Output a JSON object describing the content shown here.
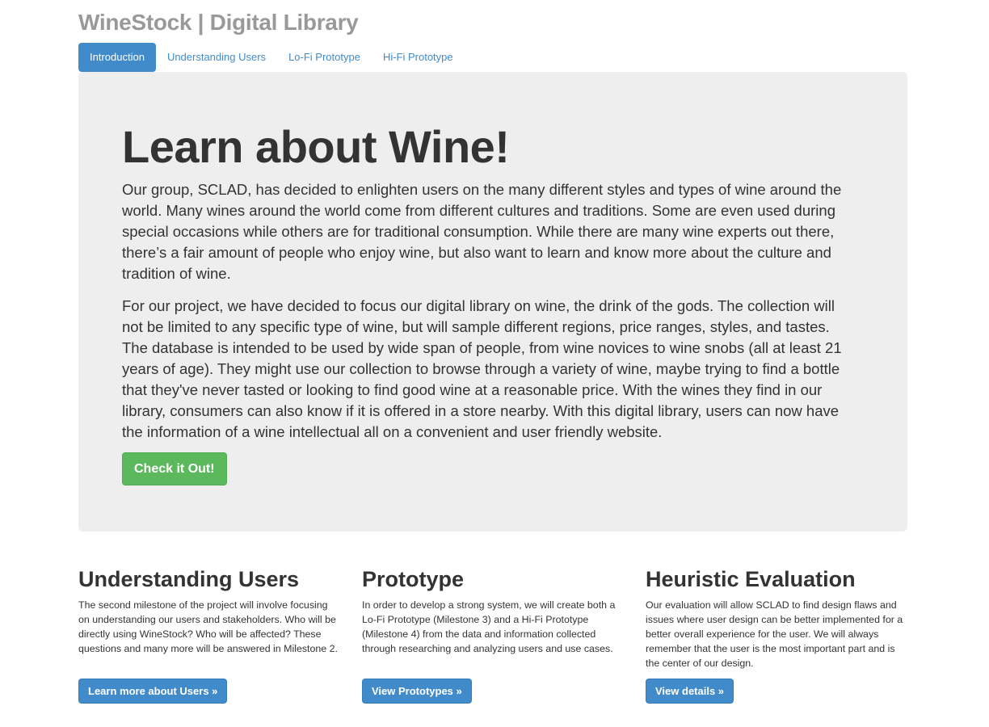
{
  "site": {
    "title": "WineStock | Digital Library"
  },
  "nav": {
    "tabs": [
      {
        "label": "Introduction",
        "active": true
      },
      {
        "label": "Understanding Users",
        "active": false
      },
      {
        "label": "Lo-Fi Prototype",
        "active": false
      },
      {
        "label": "Hi-Fi Prototype",
        "active": false
      }
    ]
  },
  "hero": {
    "heading": "Learn about Wine!",
    "paragraph_1": "Our group, SCLAD, has decided to enlighten users on the many different styles and types of wine around the world. Many wines around the world come from different cultures and traditions. Some are even used during special occasions while others are for traditional consumption. While there are many wine experts out there, there’s a fair amount of people who enjoy wine, but also want to learn and know more about the culture and tradition of wine.",
    "paragraph_2": "For our project, we have decided to focus our digital library on wine, the drink of the gods. The collection will not be limited to any specific type of wine, but will sample different regions, price ranges, styles, and tastes. The database is intended to be used by wide span of people, from wine novices to wine snobs (all at least 21 years of age). They might use our collection to browse through a variety of wine, maybe trying to find a bottle that they've never tasted or looking to find good wine at a reasonable price. With the wines they find in our library, consumers can also know if it is offered in a store nearby. With this digital library, users can now have the information of a wine intellectual all on a convenient and user friendly website.",
    "button_label": "Check it Out!"
  },
  "features": [
    {
      "heading": "Understanding Users",
      "text": "The second milestone of the project will involve focusing on understanding our users and stakeholders. Who will be directly using WineStock? Who will be affected? These questions and many more will be answered in Milestone 2.",
      "button_label": "Learn more about Users »"
    },
    {
      "heading": "Prototype",
      "text": "In order to develop a strong system, we will create both a Lo-Fi Prototype (Milestone 3) and a Hi-Fi Prototype (Milestone 4) from the data and information collected through researching and analyzing users and use cases.",
      "button_label": "View Prototypes »"
    },
    {
      "heading": "Heuristic Evaluation",
      "text": "Our evaluation will allow SCLAD to find design flaws and issues where user design can be better implemented for a better overall experience for the user. We will always remember that the user is the most important part and is the center of our design.",
      "button_label": "View details »"
    }
  ],
  "colors": {
    "primary": "#428bca",
    "success": "#5cb85c",
    "jumbotron_bg": "#eeeeee",
    "title_gray": "#999999",
    "text": "#333333"
  }
}
